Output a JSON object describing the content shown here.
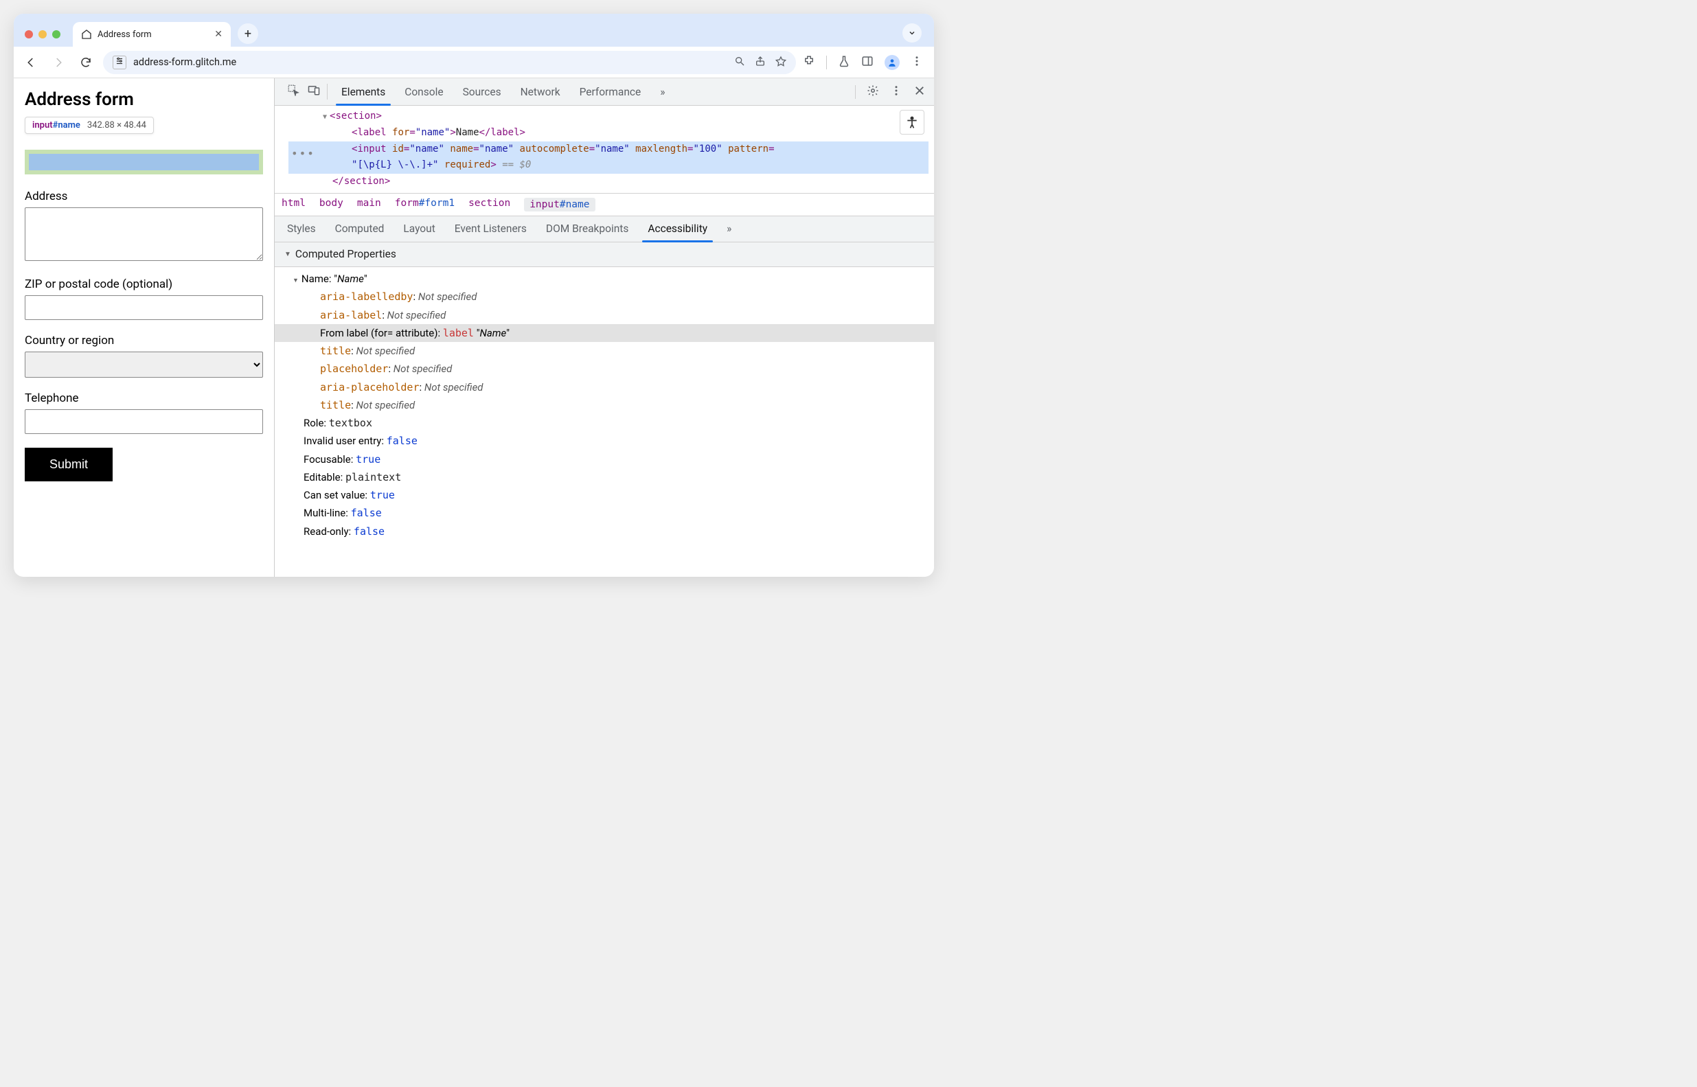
{
  "tab": {
    "title": "Address form"
  },
  "url": "address-form.glitch.me",
  "page": {
    "h1": "Address form",
    "tooltip": {
      "tag": "input",
      "id": "#name",
      "dims": "342.88 × 48.44"
    },
    "labels": {
      "address": "Address",
      "zip": "ZIP or postal code (optional)",
      "country": "Country or region",
      "telephone": "Telephone"
    },
    "submit": "Submit"
  },
  "devtools": {
    "tabs": [
      "Elements",
      "Console",
      "Sources",
      "Network",
      "Performance"
    ],
    "more_glyph": "»",
    "dom": {
      "section_open": "section",
      "label_for": "name",
      "label_text": "Name",
      "input_id": "name",
      "input_name": "name",
      "input_ac": "name",
      "input_maxlen": "100",
      "input_pattern": "[\\p{L} \\-\\.]+",
      "input_eq": " == $0",
      "required_attr": "required"
    },
    "breadcrumb": [
      "html",
      "body",
      "main",
      "form#form1",
      "section",
      "input#name"
    ],
    "subtabs": [
      "Styles",
      "Computed",
      "Layout",
      "Event Listeners",
      "DOM Breakpoints",
      "Accessibility"
    ],
    "a11y": {
      "header": "Computed Properties",
      "name_label": "Name:",
      "name_value": "Name",
      "props_ns": {
        "aria_labelledby": "aria-labelledby",
        "aria_label": "aria-label",
        "from_label": "From label (for= attribute):",
        "from_label_tag": "label",
        "title1": "title",
        "placeholder": "placeholder",
        "aria_placeholder": "aria-placeholder",
        "title2": "title",
        "not_specified": "Not specified"
      },
      "role_label": "Role:",
      "role_value": "textbox",
      "rows": [
        {
          "k": "Invalid user entry:",
          "v": "false",
          "cls": "mono-blue"
        },
        {
          "k": "Focusable:",
          "v": "true",
          "cls": "mono-blue"
        },
        {
          "k": "Editable:",
          "v": "plaintext",
          "cls": "mono-plain"
        },
        {
          "k": "Can set value:",
          "v": "true",
          "cls": "mono-blue"
        },
        {
          "k": "Multi-line:",
          "v": "false",
          "cls": "mono-blue"
        },
        {
          "k": "Read-only:",
          "v": "false",
          "cls": "mono-blue"
        }
      ]
    }
  }
}
